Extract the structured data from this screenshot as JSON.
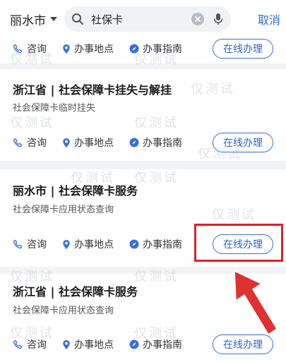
{
  "topbar": {
    "city": "丽水市",
    "search_value": "社保卡",
    "cancel_label": "取消"
  },
  "actions": {
    "consult": "咨询",
    "location": "办事地点",
    "guide": "办事指南",
    "online": "在线办理"
  },
  "cards": [
    {
      "title": "",
      "subtitle": ""
    },
    {
      "title": "浙江省 | 社会保障卡挂失与解挂",
      "subtitle": "社会保障卡临时挂失"
    },
    {
      "title": "丽水市 | 社会保障卡服务",
      "subtitle": "社会保障卡应用状态查询"
    },
    {
      "title": "浙江省 | 社会保障卡服务",
      "subtitle": "社会保障卡应用状态查询"
    }
  ],
  "watermark": "仅测试",
  "colors": {
    "accent": "#2f6bde",
    "highlight": "#d9232b",
    "arrow": "#e03131"
  }
}
